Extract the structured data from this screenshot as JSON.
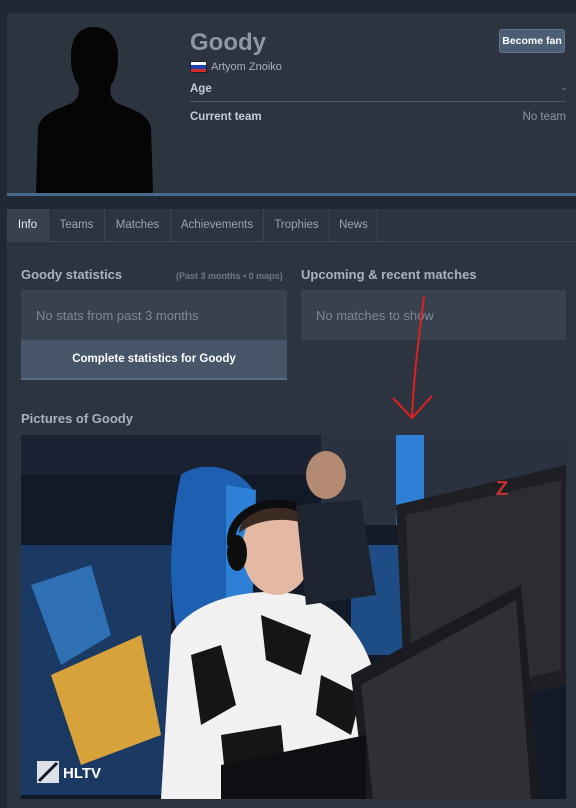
{
  "profile": {
    "nickname": "Goody",
    "real_name": "Artyom Znoiko",
    "flag_colors": [
      "#ffffff",
      "#1f3fae",
      "#d42b2b"
    ],
    "fan_button": "Become fan",
    "age_label": "Age",
    "age_value": "-",
    "team_label": "Current team",
    "team_value": "No team"
  },
  "tabs": [
    "Info",
    "Teams",
    "Matches",
    "Achievements",
    "Trophies",
    "News"
  ],
  "active_tab": "Info",
  "stats": {
    "title": "Goody statistics",
    "subtitle": "(Past 3 months • 0 maps)",
    "empty_text": "No stats from past 3 months",
    "button": "Complete statistics for Goody"
  },
  "matches": {
    "title": "Upcoming & recent matches",
    "empty_text": "No matches to show"
  },
  "pictures": {
    "title": "Pictures of Goody",
    "watermark": "HLTV"
  },
  "colors": {
    "annotation_arrow": "#e02020",
    "accent_chair_blue": "#2e7fd6"
  }
}
